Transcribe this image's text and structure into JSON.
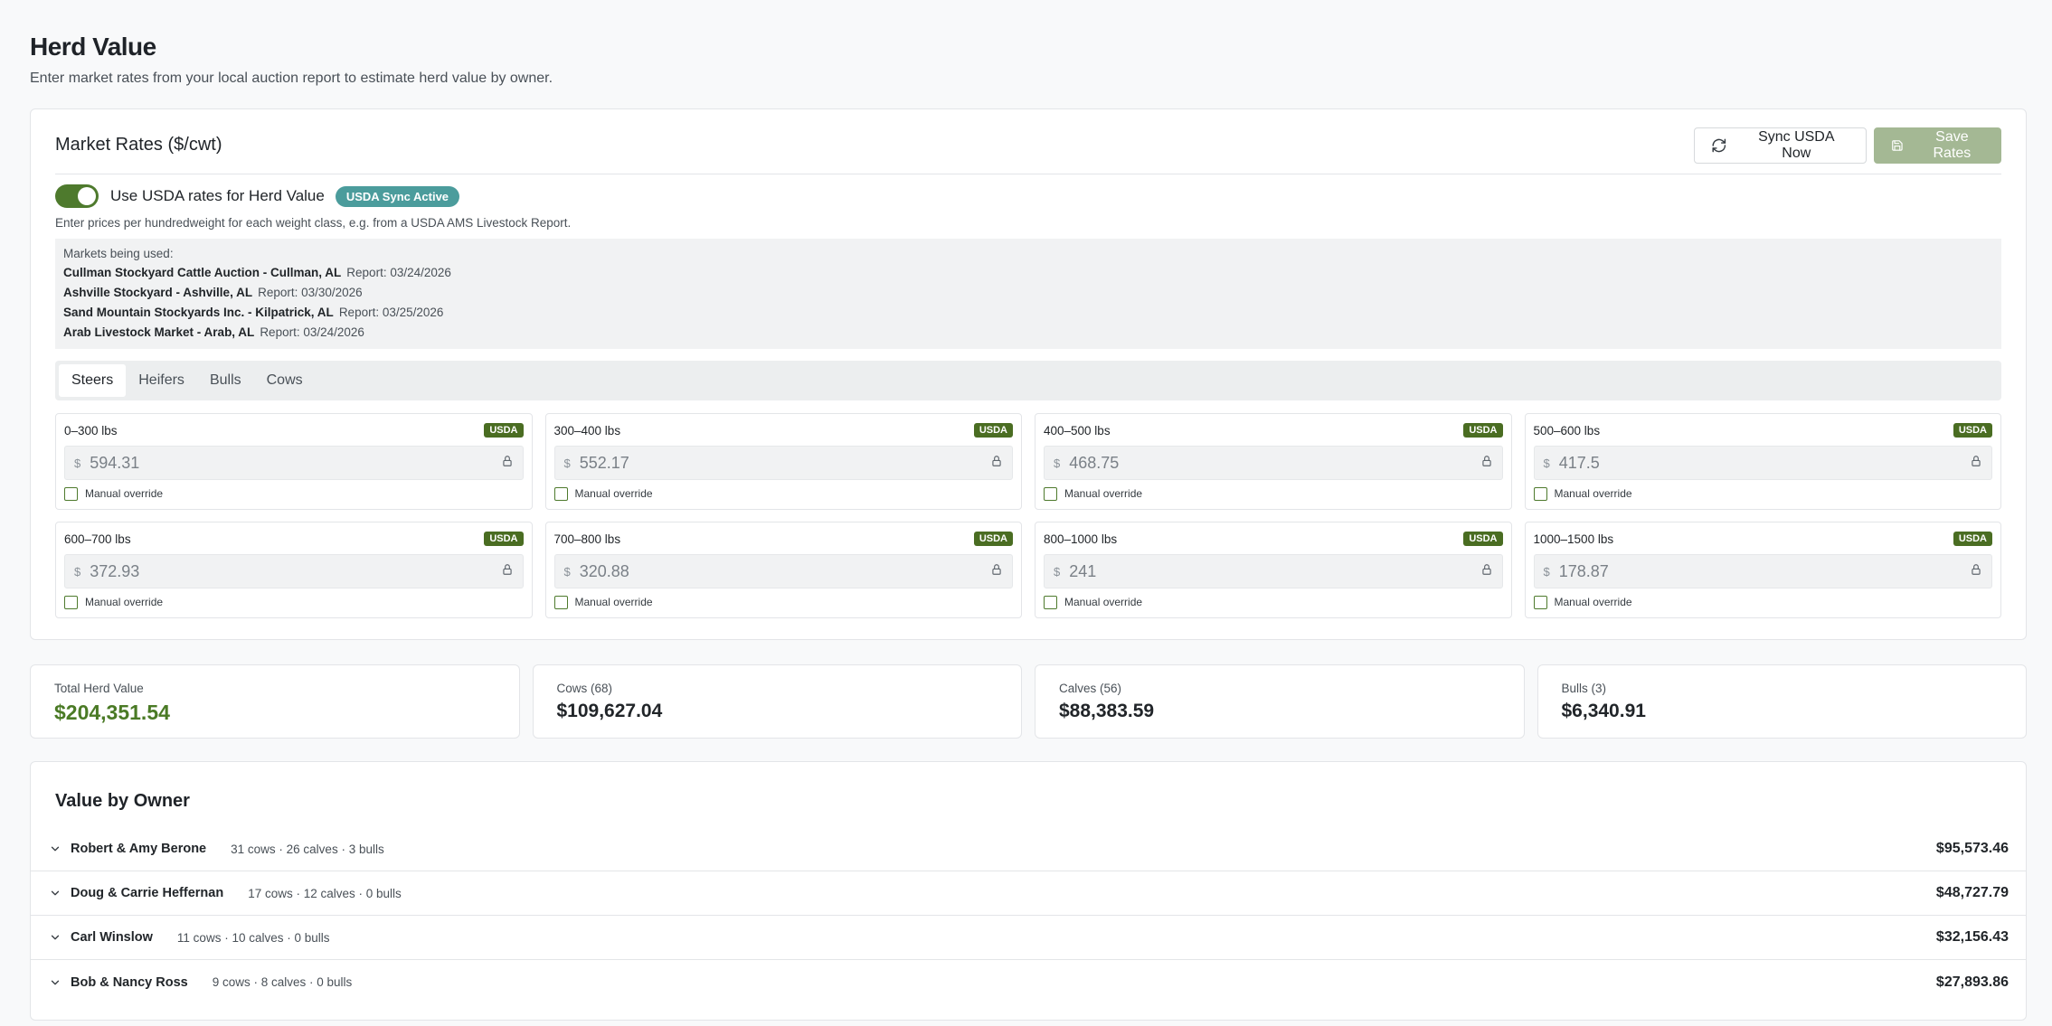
{
  "header": {
    "title": "Herd Value",
    "subtitle": "Enter market rates from your local auction report to estimate herd value by owner."
  },
  "rates": {
    "title": "Market Rates ($/cwt)",
    "sync_button": "Sync USDA Now",
    "save_button": "Save Rates",
    "toggle_label": "Use USDA rates for Herd Value",
    "toggle_on": true,
    "sync_badge": "USDA Sync Active",
    "hint": "Enter prices per hundredweight for each weight class, e.g. from a USDA AMS Livestock Report.",
    "markets_heading": "Markets being used:",
    "markets": [
      {
        "name": "Cullman Stockyard Cattle Auction - Cullman, AL",
        "report": "Report: 03/24/2026"
      },
      {
        "name": "Ashville Stockyard - Ashville, AL",
        "report": "Report: 03/30/2026"
      },
      {
        "name": "Sand Mountain Stockyards Inc. - Kilpatrick, AL",
        "report": "Report: 03/25/2026"
      },
      {
        "name": "Arab Livestock Market - Arab, AL",
        "report": "Report: 03/24/2026"
      }
    ],
    "tabs": [
      "Steers",
      "Heifers",
      "Bulls",
      "Cows"
    ],
    "active_tab": "Steers",
    "currency_symbol": "$",
    "badge": "USDA",
    "override_label": "Manual override",
    "weight_classes": [
      {
        "label": "0–300 lbs",
        "value": "594.31"
      },
      {
        "label": "300–400 lbs",
        "value": "552.17"
      },
      {
        "label": "400–500 lbs",
        "value": "468.75"
      },
      {
        "label": "500–600 lbs",
        "value": "417.5"
      },
      {
        "label": "600–700 lbs",
        "value": "372.93"
      },
      {
        "label": "700–800 lbs",
        "value": "320.88"
      },
      {
        "label": "800–1000 lbs",
        "value": "241"
      },
      {
        "label": "1000–1500 lbs",
        "value": "178.87"
      }
    ]
  },
  "stats": {
    "total": {
      "label": "Total Herd Value",
      "value": "$204,351.54"
    },
    "cows": {
      "label": "Cows (68)",
      "value": "$109,627.04"
    },
    "calves": {
      "label": "Calves (56)",
      "value": "$88,383.59"
    },
    "bulls": {
      "label": "Bulls (3)",
      "value": "$6,340.91"
    }
  },
  "owners": {
    "title": "Value by Owner",
    "rows": [
      {
        "name": "Robert & Amy Berone",
        "counts": "31 cows · 26 calves · 3 bulls",
        "total": "$95,573.46"
      },
      {
        "name": "Doug & Carrie Heffernan",
        "counts": "17 cows · 12 calves · 0 bulls",
        "total": "$48,727.79"
      },
      {
        "name": "Carl Winslow",
        "counts": "11 cows · 10 calves · 0 bulls",
        "total": "$32,156.43"
      },
      {
        "name": "Bob & Nancy Ross",
        "counts": "9 cows · 8 calves · 0 bulls",
        "total": "$27,893.86"
      }
    ]
  },
  "colors": {
    "brand_green": "#4e7a2d",
    "usda_chip": "#4a6d22",
    "sync_badge": "#4b9c9c",
    "total_value": "#4a7a25",
    "save_disabled": "#a4b894"
  },
  "icons": {
    "sync": "refresh-icon",
    "save": "save-icon",
    "lock": "lock-icon",
    "chevron": "chevron-down-icon"
  }
}
